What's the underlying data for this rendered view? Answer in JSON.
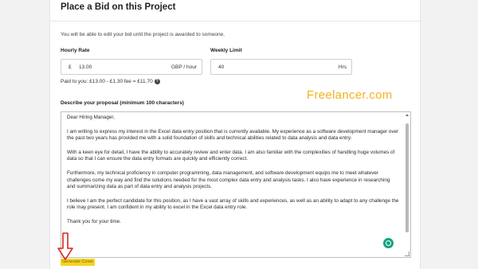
{
  "panel": {
    "title": "Place a Bid on this Project",
    "note": "You will be able to edit your bid until the project is awarded to someone."
  },
  "hourly_rate": {
    "label": "Hourly Rate",
    "currency_symbol": "£",
    "value": "13.00",
    "unit": "GBP / hour"
  },
  "weekly_limit": {
    "label": "Weekly Limit",
    "value": "40",
    "unit": "Hrs"
  },
  "paid_to_you": "Paid to you: £13.00 - £1.30 fee = £11.70",
  "watermark": "Freelancer.com",
  "proposal": {
    "label": "Describe your proposal (minimum 100 characters)",
    "paragraphs": [
      "Dear Hiring Manager,",
      "I am writing to express my interest in the Excel data entry position that is currently available. My experience as a software development manager over the past two years has provided me with a solid foundation of skills and technical abilities related to data analysis and data entry.",
      "With a keen eye for detail, I have the ability to accurately review and enter data. I am also familiar with the complexities of handling huge volumes of data so that I can ensure the data entry formats are quickly and efficiently correct.",
      "Furthermore, my technical proficiency in computer programming, data management, and software development equips me to meet whatever challenges come my way and find the solutions needed for the most complex data entry and analysis tasks. I also have experience in researching and summarizing data as part of data entry and analysis projects.",
      "I believe I am the perfect candidate for this position, as I have a vast array of skills and experiences, as well as an ability to adapt to any challenge the role may present. I am confident in my ability to excel in the Excel data entry role.",
      "Thank you for your time."
    ]
  },
  "generate_button": "Generate Cover",
  "colors": {
    "accent_yellow": "#f5d423",
    "watermark": "#f2b21f",
    "arrow": "#d9261c",
    "grammar_badge": "#14a37f"
  }
}
